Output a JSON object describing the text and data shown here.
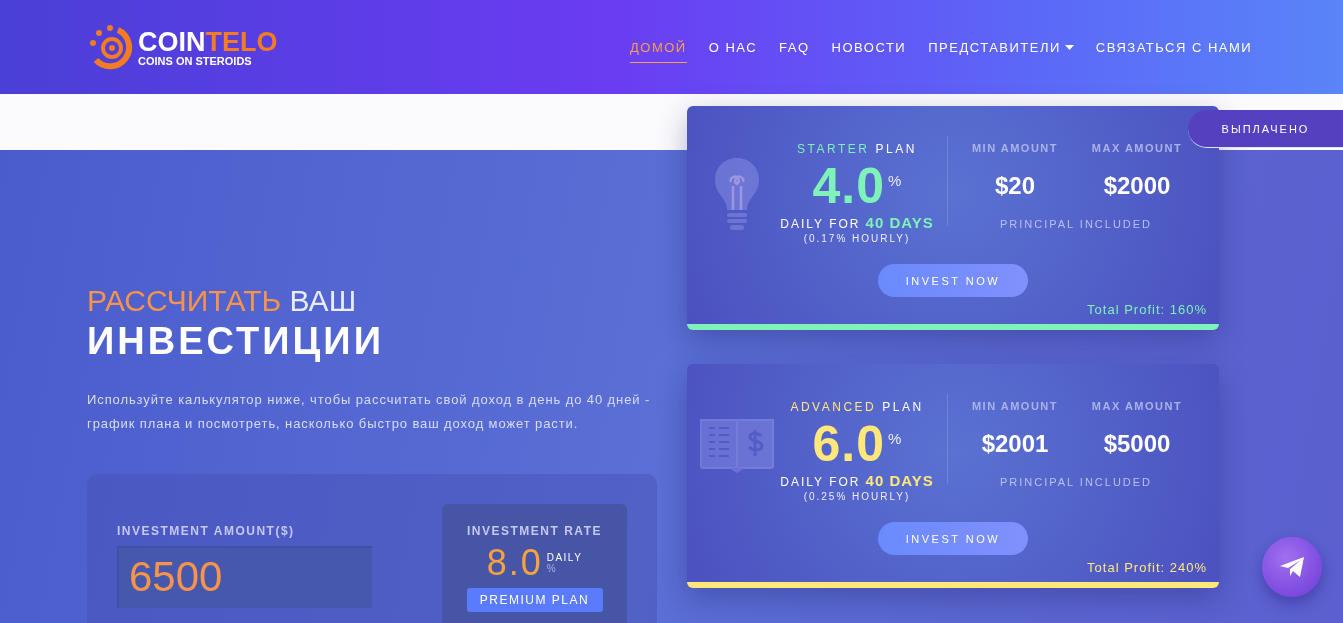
{
  "logo": {
    "name_part1": "COIN",
    "name_part2": "TELO",
    "tagline": "COINS ON STEROIDS"
  },
  "nav": [
    {
      "label": "ДОМОЙ",
      "selected": true,
      "has_menu": false
    },
    {
      "label": "О НАС",
      "selected": false,
      "has_menu": false
    },
    {
      "label": "FAQ",
      "selected": false,
      "has_menu": false
    },
    {
      "label": "НОВОСТИ",
      "selected": false,
      "has_menu": false
    },
    {
      "label": "ПРЕДСТАВИТЕЛИ",
      "selected": false,
      "has_menu": true
    },
    {
      "label": "СВЯЗАТЬСЯ С НАМИ",
      "selected": false,
      "has_menu": false
    }
  ],
  "hero": {
    "title_accent": "РАССЧИТАТЬ",
    "title_rest": "ВАШ",
    "title_line2": "ИНВЕСТИЦИИ",
    "description": "Используйте калькулятор ниже, чтобы рассчитать свой доход в день до 40 дней - график плана и посмотреть, насколько быстро ваш доход может расти."
  },
  "calculator": {
    "amount_label": "INVESTMENT AMOUNT($)",
    "amount_value": "6500",
    "rate_label": "INVESTMENT RATE",
    "rate": "8.0",
    "rate_period": "DAILY",
    "rate_unit": "%",
    "plan_button": "PREMIUM PLAN"
  },
  "plans": [
    {
      "kind": "bulb",
      "color": "#7ef2b8",
      "name": "STARTER",
      "name_suffix": "PLAN",
      "rate": "4.0",
      "rate_unit": "%",
      "daily_prefix": "DAILY FOR",
      "days": "40 DAYS",
      "hourly": "(0.17% HOURLY)",
      "min_label": "MIN AMOUNT",
      "max_label": "MAX AMOUNT",
      "min": "$20",
      "max": "$2000",
      "principal": "PRINCIPAL INCLUDED",
      "button": "INVEST NOW",
      "total_profit": "Total Profit: 160%"
    },
    {
      "kind": "book",
      "color": "#ffe77a",
      "name": "ADVANCED",
      "name_suffix": "PLAN",
      "rate": "6.0",
      "rate_unit": "%",
      "daily_prefix": "DAILY FOR",
      "days": "40 DAYS",
      "hourly": "(0.25% HOURLY)",
      "min_label": "MIN AMOUNT",
      "max_label": "MAX AMOUNT",
      "min": "$2001",
      "max": "$5000",
      "principal": "PRINCIPAL INCLUDED",
      "button": "INVEST NOW",
      "total_profit": "Total Profit: 240%"
    }
  ],
  "payout_tab": {
    "label": "ВЫПЛАЧЕНО"
  }
}
